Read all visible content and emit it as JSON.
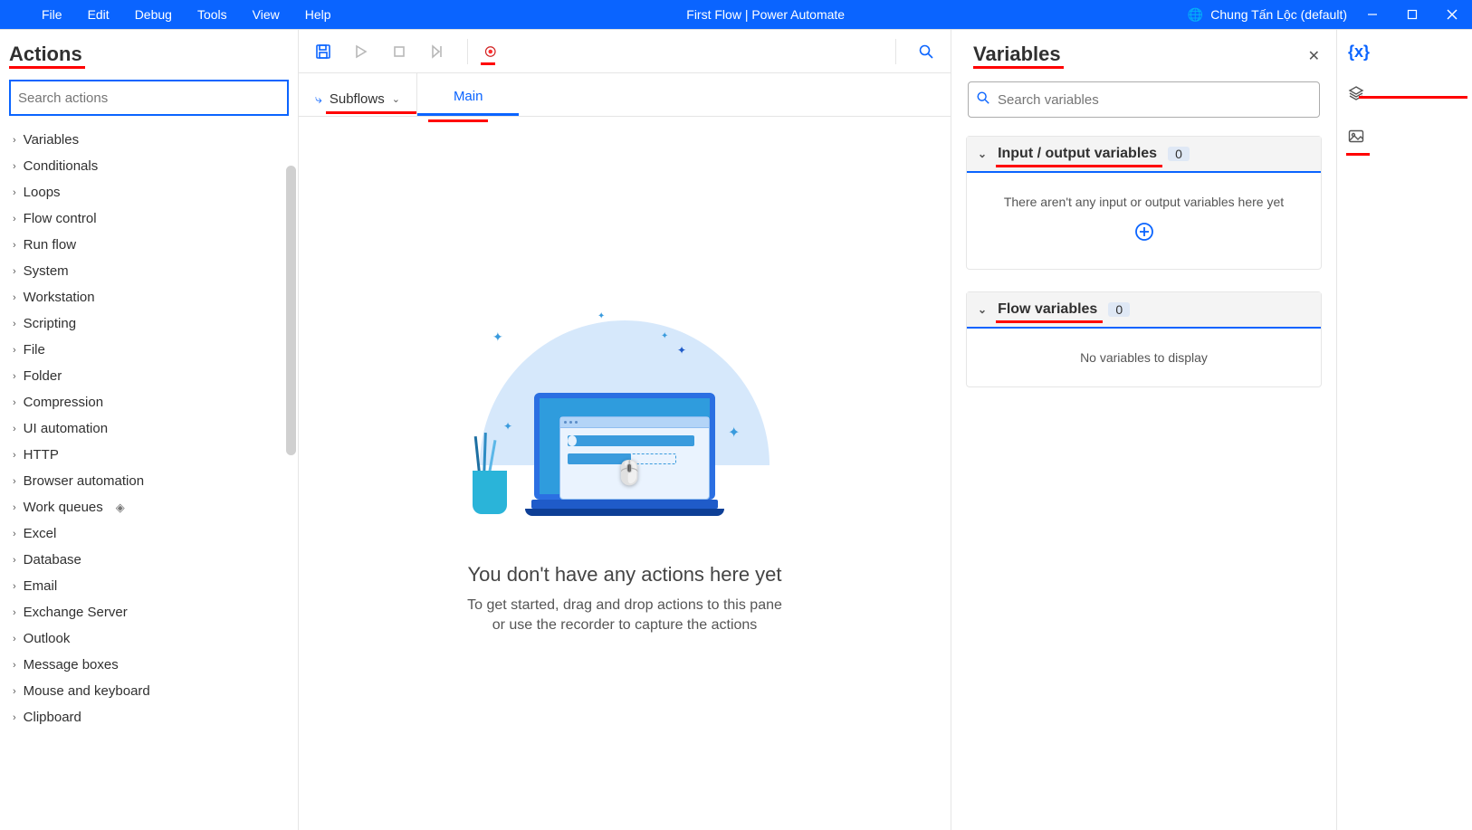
{
  "titlebar": {
    "menus": [
      "File",
      "Edit",
      "Debug",
      "Tools",
      "View",
      "Help"
    ],
    "flow_title": "First Flow | Power Automate",
    "profile_name": "Chung Tấn Lộc  (default)"
  },
  "actions_panel": {
    "heading": "Actions",
    "search_placeholder": "Search actions",
    "categories": [
      "Variables",
      "Conditionals",
      "Loops",
      "Flow control",
      "Run flow",
      "System",
      "Workstation",
      "Scripting",
      "File",
      "Folder",
      "Compression",
      "UI automation",
      "HTTP",
      "Browser automation",
      "Work queues",
      "Excel",
      "Database",
      "Email",
      "Exchange Server",
      "Outlook",
      "Message boxes",
      "Mouse and keyboard",
      "Clipboard"
    ],
    "premium_index": 14
  },
  "center": {
    "subflows_label": "Subflows",
    "tab_main": "Main",
    "empty_heading": "You don't have any actions here yet",
    "empty_text_l1": "To get started, drag and drop actions to this pane",
    "empty_text_l2": "or use the recorder to capture the actions"
  },
  "variables_panel": {
    "heading": "Variables",
    "search_placeholder": "Search variables",
    "sec1_title": "Input / output variables",
    "sec1_count": "0",
    "sec1_empty": "There aren't any input or output variables here yet",
    "sec2_title": "Flow variables",
    "sec2_count": "0",
    "sec2_empty": "No variables to display"
  },
  "far_panel": {
    "var_symbol": "{x}"
  }
}
